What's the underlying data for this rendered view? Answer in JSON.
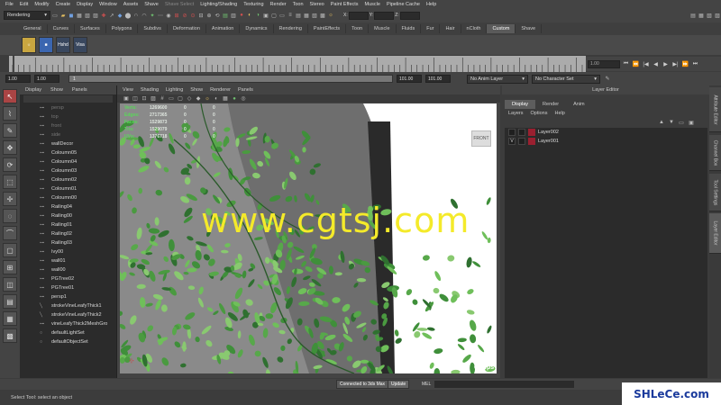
{
  "menubar": [
    "File",
    "Edit",
    "Modify",
    "Create",
    "Display",
    "Window",
    "Assets",
    "Shave",
    "Shave Select",
    "Lighting/Shading",
    "Texturing",
    "Render",
    "Toon",
    "Stereo",
    "Paint Effects",
    "Muscle",
    "Pipeline Cache",
    "Help"
  ],
  "statusline": {
    "mode": "Rendering",
    "x_label": "X:",
    "y_label": "Y:",
    "z_label": "Z:"
  },
  "shelf": {
    "tabs": [
      "General",
      "Curves",
      "Surfaces",
      "Polygons",
      "Subdivs",
      "Deformation",
      "Animation",
      "Dynamics",
      "Rendering",
      "PaintEffects",
      "Toon",
      "Muscle",
      "Fluids",
      "Fur",
      "Hair",
      "nCloth",
      "Custom",
      "Shave"
    ],
    "active_tab": "Custom",
    "buttons": [
      "Hshd",
      "Visa"
    ]
  },
  "timeslider": {
    "current_frame": "1.00",
    "start": 1,
    "end": 101
  },
  "range": {
    "start": "1.00",
    "start2": "1.00",
    "current": "1",
    "end": "101.00",
    "end2": "101.00",
    "anim_layer": "No Anim Layer",
    "char_set": "No Character Set"
  },
  "outliner": {
    "menu": [
      "Display",
      "Show",
      "Panels"
    ],
    "items": [
      {
        "label": "persp",
        "dim": true
      },
      {
        "label": "top",
        "dim": true
      },
      {
        "label": "front",
        "dim": true
      },
      {
        "label": "side",
        "dim": true
      },
      {
        "label": "wallDecor",
        "dim": false
      },
      {
        "label": "Coloumn05",
        "dim": false
      },
      {
        "label": "Coloumn04",
        "dim": false
      },
      {
        "label": "Coloumn03",
        "dim": false
      },
      {
        "label": "Coloumn02",
        "dim": false
      },
      {
        "label": "Coloumn01",
        "dim": false
      },
      {
        "label": "Coloumn00",
        "dim": false
      },
      {
        "label": "Railing04",
        "dim": false
      },
      {
        "label": "Railing00",
        "dim": false
      },
      {
        "label": "Railing01",
        "dim": false
      },
      {
        "label": "Railing02",
        "dim": false
      },
      {
        "label": "Railing03",
        "dim": false
      },
      {
        "label": "Ivy00",
        "dim": false
      },
      {
        "label": "wall01",
        "dim": false
      },
      {
        "label": "wall00",
        "dim": false
      },
      {
        "label": "PGTree02",
        "dim": false
      },
      {
        "label": "PGTree01",
        "dim": false
      },
      {
        "label": "persp1",
        "dim": false
      },
      {
        "label": "strokeVineLeafyThick1",
        "dim": false
      },
      {
        "label": "strokeVineLeafyThick2",
        "dim": false
      },
      {
        "label": "vineLeafyThick2MeshGro",
        "dim": false
      },
      {
        "label": "defaultLightSet",
        "dim": false
      },
      {
        "label": "defaultObjectSet",
        "dim": false
      }
    ]
  },
  "viewport": {
    "menu": [
      "View",
      "Shading",
      "Lighting",
      "Show",
      "Renderer",
      "Panels"
    ],
    "hud": [
      {
        "label": "Verts:",
        "v1": "1269600",
        "v2": "0",
        "v3": "0"
      },
      {
        "label": "Edges:",
        "v1": "2717365",
        "v2": "0",
        "v3": "0"
      },
      {
        "label": "Faces:",
        "v1": "1529873",
        "v2": "0",
        "v3": "0"
      },
      {
        "label": "Tris:",
        "v1": "1529079",
        "v2": "0",
        "v3": "0"
      },
      {
        "label": "UVs:",
        "v1": "1376718",
        "v2": "0",
        "v3": "0"
      }
    ],
    "cube_label": "FRONT",
    "fps": "0.3 fps",
    "watermark": "www.cgtsj.com"
  },
  "layer_editor": {
    "title": "Layer Editor",
    "tabs": [
      "Display",
      "Render",
      "Anim"
    ],
    "active_tab": "Display",
    "menu": [
      "Layers",
      "Options",
      "Help"
    ],
    "layers": [
      {
        "visible": "",
        "name": "Layer002",
        "color": "#9a2030"
      },
      {
        "visible": "V",
        "name": "Layer001",
        "color": "#9a2030"
      }
    ]
  },
  "sidetabs": [
    "Attribute Editor",
    "Channel Box",
    "Tool Settings",
    "Layer Editor"
  ],
  "cmdline": {
    "connected": "Connected to 3ds Max",
    "update": "Update",
    "mel": "MEL"
  },
  "helpline": "Select Tool: select an object",
  "logo": "SHLeCe.com"
}
